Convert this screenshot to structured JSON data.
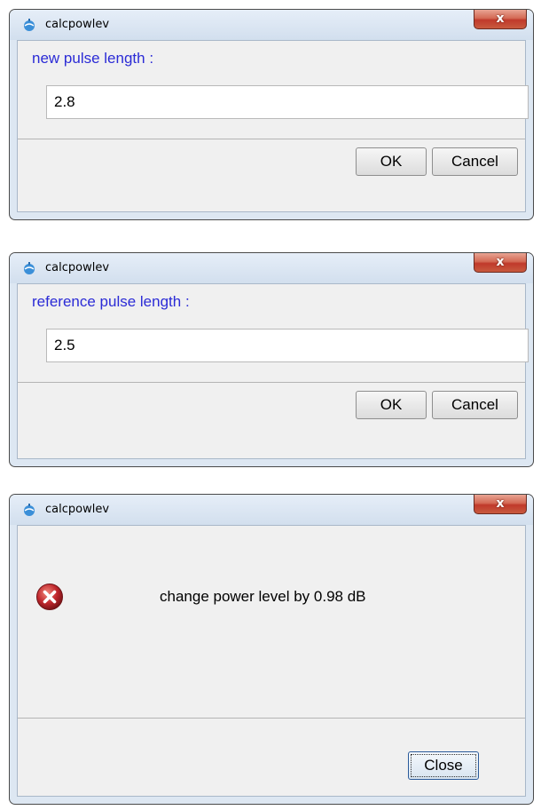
{
  "dialogs": [
    {
      "title": "calcpowlev",
      "prompt": "new pulse length :",
      "input_value": "2.8",
      "ok_label": "OK",
      "cancel_label": "Cancel"
    },
    {
      "title": "calcpowlev",
      "prompt": "reference pulse length :",
      "input_value": "2.5",
      "ok_label": "OK",
      "cancel_label": "Cancel"
    },
    {
      "title": "calcpowlev",
      "message": "change power level by 0.98 dB",
      "close_label": "Close",
      "message_icon": "error-icon"
    }
  ],
  "window_close_glyph": "x",
  "colors": {
    "prompt_text": "#2b2bd6",
    "close_button_red": "#c0392b",
    "error_icon_red": "#c0272d"
  }
}
